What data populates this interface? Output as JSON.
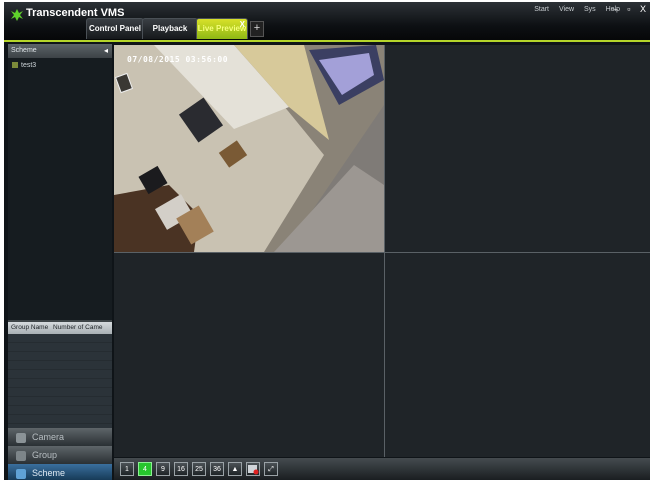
{
  "app": {
    "title": "Transcendent VMS",
    "colors": {
      "accent": "#b5d52a",
      "selected_cell": "#2fdc3a",
      "active_tab": "#c7d62a"
    }
  },
  "tabs": [
    {
      "label": "Control Panel",
      "active": false
    },
    {
      "label": "Playback",
      "active": false
    },
    {
      "label": "Live Preview",
      "active": true,
      "close": "X"
    }
  ],
  "add_tab": "+",
  "menu": [
    "Start",
    "View",
    "Sys",
    "Help"
  ],
  "window_controls": {
    "minimize": "–",
    "restore": "▫",
    "close": "X"
  },
  "sidebar": {
    "header": "Scheme",
    "collapse": "◂",
    "tree": [
      {
        "label": "test3",
        "icon": "camera-node-icon"
      }
    ],
    "grid_columns": [
      "Group Name",
      "Number of Came"
    ],
    "nav": [
      {
        "label": "Camera",
        "icon": "camera-icon",
        "active": false
      },
      {
        "label": "Group",
        "icon": "group-icon",
        "active": false
      },
      {
        "label": "Scheme",
        "icon": "scheme-icon",
        "active": true
      }
    ]
  },
  "video": {
    "layout": "2x2",
    "cells": [
      {
        "timestamp": "07/08/2015 03:56:00",
        "live": true,
        "selected": true
      },
      {
        "timestamp": "",
        "live": false,
        "selected": false
      },
      {
        "timestamp": "",
        "live": false,
        "selected": false
      },
      {
        "timestamp": "",
        "live": false,
        "selected": false
      }
    ]
  },
  "toolbar": {
    "buttons": [
      {
        "label": "1",
        "name": "layout-1-button",
        "active": false
      },
      {
        "label": "4",
        "name": "layout-4-button",
        "active": true
      },
      {
        "label": "9",
        "name": "layout-9-button",
        "active": false
      },
      {
        "label": "16",
        "name": "layout-16-button",
        "active": false
      },
      {
        "label": "25",
        "name": "layout-25-button",
        "active": false
      },
      {
        "label": "36",
        "name": "layout-36-button",
        "active": false
      },
      {
        "label": "▲",
        "name": "eject-icon",
        "active": false
      },
      {
        "label": "",
        "name": "screenshot-icon",
        "active": false
      },
      {
        "label": "⤢",
        "name": "fullscreen-icon",
        "active": false
      }
    ]
  }
}
